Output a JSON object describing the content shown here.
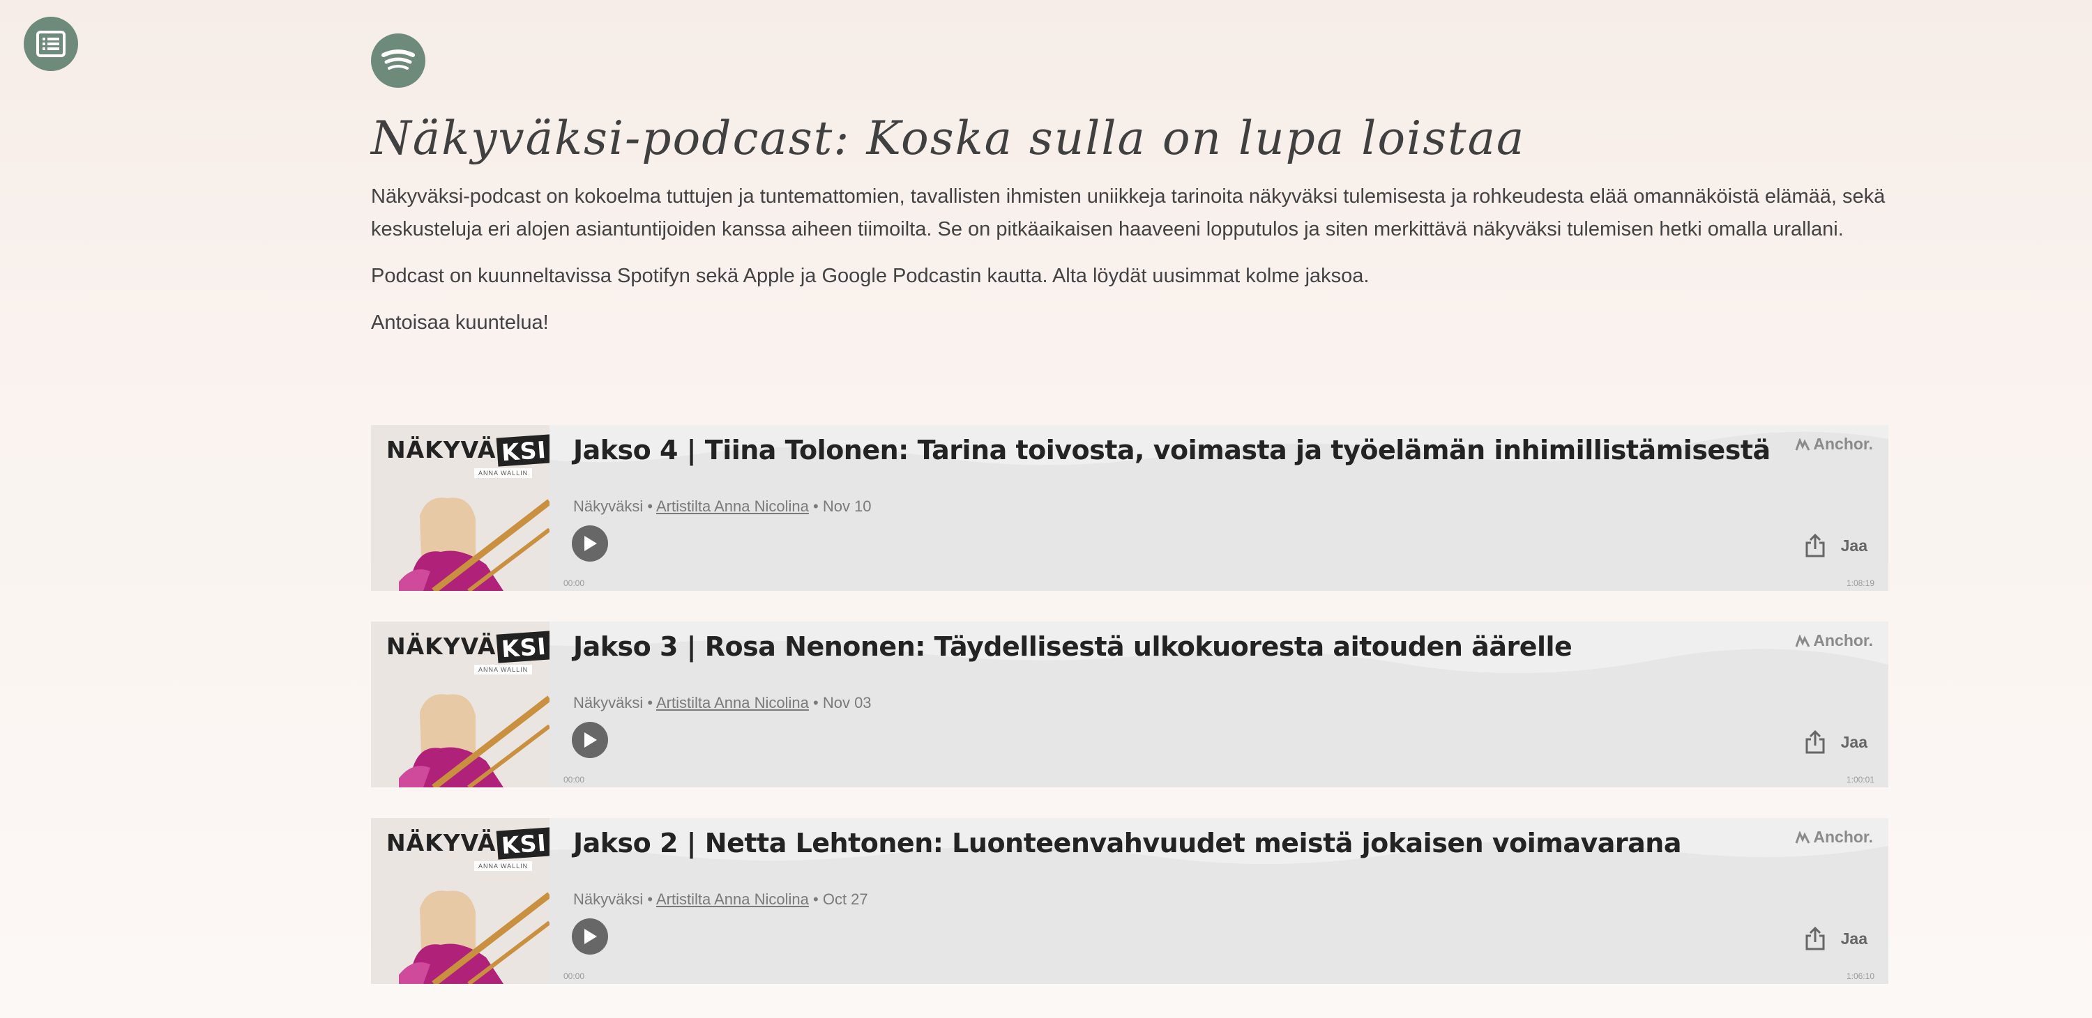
{
  "icons": {
    "toc": "list-icon",
    "spotify": "spotify-icon",
    "play": "play-icon",
    "share": "share-icon",
    "anchor": "anchor-logo-icon"
  },
  "colors": {
    "icon_circle": "#6e8a7a",
    "card_bg": "#e6e6e6",
    "play_button": "#676767"
  },
  "page": {
    "title": "Näkyväksi-podcast: Koska sulla on lupa loistaa",
    "paragraphs": [
      "Näkyväksi-podcast on kokoelma tuttujen ja tuntemattomien, tavallisten ihmisten uniikkeja tarinoita näkyväksi tulemisesta ja rohkeudesta elää omannäköistä elämää, sekä keskusteluja eri alojen asiantuntijoiden kanssa aiheen tiimoilta. Se on pitkäaikaisen haaveeni lopputulos ja siten merkittävä näkyväksi tulemisen hetki omalla urallani.",
      "Podcast on kuunneltavissa Spotifyn sekä Apple ja Google Podcastin kautta. Alta löydät uusimmat kolme jaksoa.",
      "Antoisaa kuuntelua!"
    ]
  },
  "episodes": [
    {
      "cover_brand": "NÄKYVÄ",
      "cover_brand_box": "KSI",
      "cover_sub": "ANNA WALLIN",
      "title": "Jakso 4 | Tiina Tolonen: Tarina toivosta, voimasta ja työelämän inhimillistämisestä",
      "show": "Näkyväksi",
      "sep1": "•",
      "artist": "Artistilta Anna Nicolina",
      "sep2": "•",
      "date": "Nov 10",
      "anchor": "Anchor.",
      "share": "Jaa",
      "time_start": "00:00",
      "time_end": "1:08:19"
    },
    {
      "cover_brand": "NÄKYVÄ",
      "cover_brand_box": "KSI",
      "cover_sub": "ANNA WALLIN",
      "title": "Jakso 3 | Rosa Nenonen: Täydellisestä ulkokuoresta aitouden äärelle",
      "show": "Näkyväksi",
      "sep1": "•",
      "artist": "Artistilta Anna Nicolina",
      "sep2": "•",
      "date": "Nov 03",
      "anchor": "Anchor.",
      "share": "Jaa",
      "time_start": "00:00",
      "time_end": "1:00:01"
    },
    {
      "cover_brand": "NÄKYVÄ",
      "cover_brand_box": "KSI",
      "cover_sub": "ANNA WALLIN",
      "title": "Jakso 2 | Netta Lehtonen: Luonteenvahvuudet meistä jokaisen voimavarana",
      "show": "Näkyväksi",
      "sep1": "•",
      "artist": "Artistilta Anna Nicolina",
      "sep2": "•",
      "date": "Oct 27",
      "anchor": "Anchor.",
      "share": "Jaa",
      "time_start": "00:00",
      "time_end": "1:06:10"
    }
  ]
}
